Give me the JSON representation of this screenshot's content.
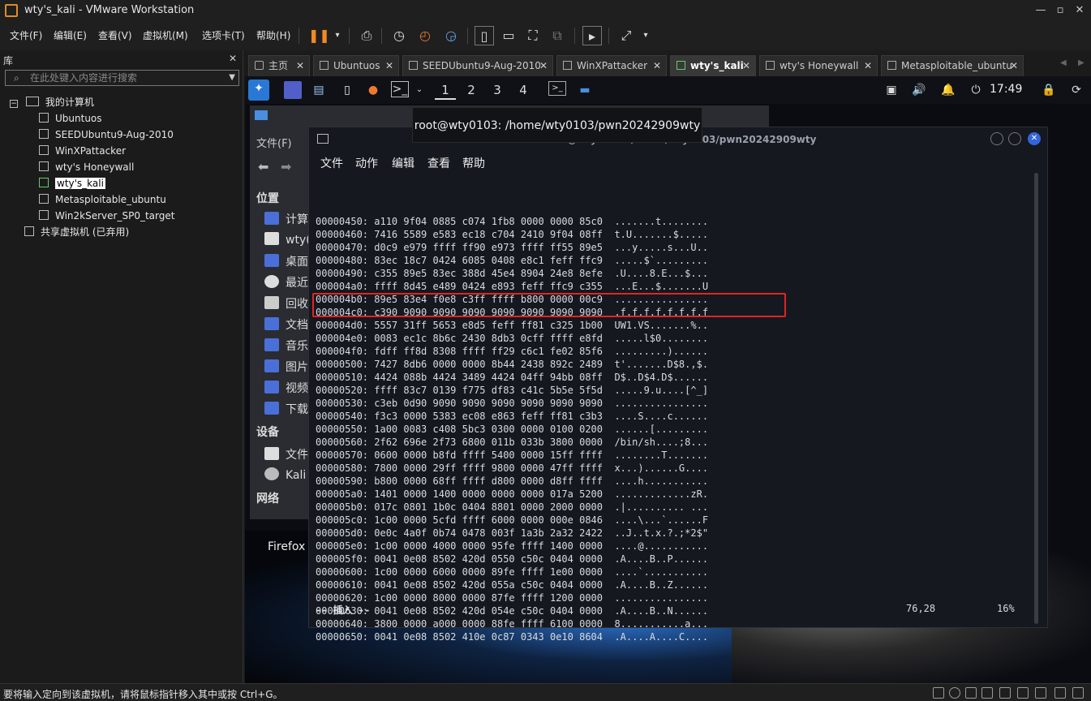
{
  "window": {
    "title": "wty's_kali - VMware Workstation"
  },
  "menu": [
    "文件(F)",
    "编辑(E)",
    "查看(V)",
    "虚拟机(M)",
    "选项卡(T)",
    "帮助(H)"
  ],
  "library": {
    "title": "库",
    "search_placeholder": "在此处键入内容进行搜索",
    "root": "我的计算机",
    "vms": [
      "Ubuntuos",
      "SEEDUbuntu9-Aug-2010",
      "WinXPattacker",
      "wty's Honeywall",
      "wty's_kali",
      "Metasploitable_ubuntu",
      "Win2kServer_SP0_target"
    ],
    "selected": "wty's_kali",
    "shared": "共享虚拟机 (已弃用)"
  },
  "tabs": [
    {
      "label": "主页"
    },
    {
      "label": "Ubuntuos"
    },
    {
      "label": "SEEDUbuntu9-Aug-2010"
    },
    {
      "label": "WinXPattacker"
    },
    {
      "label": "wty's_kali"
    },
    {
      "label": "wty's Honeywall"
    },
    {
      "label": "Metasploitable_ubuntu"
    }
  ],
  "guest": {
    "workspaces": [
      "1",
      "2",
      "3",
      "4"
    ],
    "active_workspace": "1",
    "clock": "17:49",
    "tooltip": "root@wty0103: /home/wty0103/pwn20242909wty",
    "filemanager": {
      "menu": "文件(F)",
      "sections": {
        "places": "位置",
        "devices": "设备",
        "network": "网络"
      },
      "places": [
        "计算",
        "wty(",
        "桌面",
        "最近",
        "回收",
        "文档",
        "音乐",
        "图片",
        "视频",
        "下载"
      ],
      "devices": [
        "文件",
        "Kali"
      ]
    },
    "desktop_label": "Firefox",
    "terminal": {
      "title": "root@wty0103: /home/wty0103/pwn20242909wty",
      "menu": [
        "文件",
        "动作",
        "编辑",
        "查看",
        "帮助"
      ],
      "hex_lines": [
        "00000450: a110 9f04 0885 c074 1fb8 0000 0000 85c0  .......t........",
        "00000460: 7416 5589 e583 ec18 c704 2410 9f04 08ff  t.U.......$.....",
        "00000470: d0c9 e979 ffff ff90 e973 ffff ff55 89e5  ...y.....s...U..",
        "00000480: 83ec 18c7 0424 6085 0408 e8c1 feff ffc9  .....$`.........",
        "00000490: c355 89e5 83ec 388d 45e4 8904 24e8 8efe  .U....8.E...$...",
        "000004a0: ffff 8d45 e489 0424 e893 feff ffc9 c355  ...E...$.......U",
        "000004b0: 89e5 83e4 f0e8 c3ff ffff b800 0000 00c9  ................",
        "000004c0: c390 9090 9090 9090 9090 9090 9090 9090  .f.f.f.f.f.f.f.f",
        "000004d0: 5557 31ff 5653 e8d5 feff ff81 c325 1b00  UW1.VS.......%..",
        "000004e0: 0083 ec1c 8b6c 2430 8db3 0cff ffff e8fd  .....l$0........",
        "000004f0: fdff ff8d 8308 ffff ff29 c6c1 fe02 85f6  .........)......",
        "00000500: 7427 8db6 0000 0000 8b44 2438 892c 2489  t'.......D$8.,$.",
        "00000510: 4424 088b 4424 3489 4424 04ff 94bb 08ff  D$..D$4.D$......",
        "00000520: ffff 83c7 0139 f775 df83 c41c 5b5e 5f5d  .....9.u....[^_]",
        "00000530: c3eb 0d90 9090 9090 9090 9090 9090 9090  ................",
        "00000540: f3c3 0000 5383 ec08 e863 feff ff81 c3b3  ....S....c......",
        "00000550: 1a00 0083 c408 5bc3 0300 0000 0100 0200  ......[.........",
        "00000560: 2f62 696e 2f73 6800 011b 033b 3800 0000  /bin/sh....;8...",
        "00000570: 0600 0000 b8fd ffff 5400 0000 15ff ffff  ........T.......",
        "00000580: 7800 0000 29ff ffff 9800 0000 47ff ffff  x...)......G....",
        "00000590: b800 0000 68ff ffff d800 0000 d8ff ffff  ....h...........",
        "000005a0: 1401 0000 1400 0000 0000 0000 017a 5200  .............zR.",
        "000005b0: 017c 0801 1b0c 0404 8801 0000 2000 0000  .|.......... ...",
        "000005c0: 1c00 0000 5cfd ffff 6000 0000 000e 0846  ....\\...`......F",
        "000005d0: 0e0c 4a0f 0b74 0478 003f 1a3b 2a32 2422  ..J..t.x.?.;*2$\"",
        "000005e0: 1c00 0000 4000 0000 95fe ffff 1400 0000  ....@...........",
        "000005f0: 0041 0e08 8502 420d 0550 c50c 0404 0000  .A....B..P......",
        "00000600: 1c00 0000 6000 0000 89fe ffff 1e00 0000  ....`...........",
        "00000610: 0041 0e08 8502 420d 055a c50c 0404 0000  .A....B..Z......",
        "00000620: 1c00 0000 8000 0000 87fe ffff 1200 0000  ................",
        "00000630: 0041 0e08 8502 420d 054e c50c 0404 0000  .A....B..N......",
        "00000640: 3800 0000 a000 0000 88fe ffff 6100 0000  8...........a...",
        "00000650: 0041 0e08 8502 410e 0c87 0343 0e10 8604  .A....A....C...."
      ],
      "mode": "-- 插入 --",
      "position": "76,28",
      "percent": "16%"
    }
  },
  "status": {
    "message": "要将输入定向到该虚拟机，请将鼠标指针移入其中或按 Ctrl+G。"
  },
  "colors": {
    "highlight": "#e02525",
    "accent": "#3465d9"
  }
}
